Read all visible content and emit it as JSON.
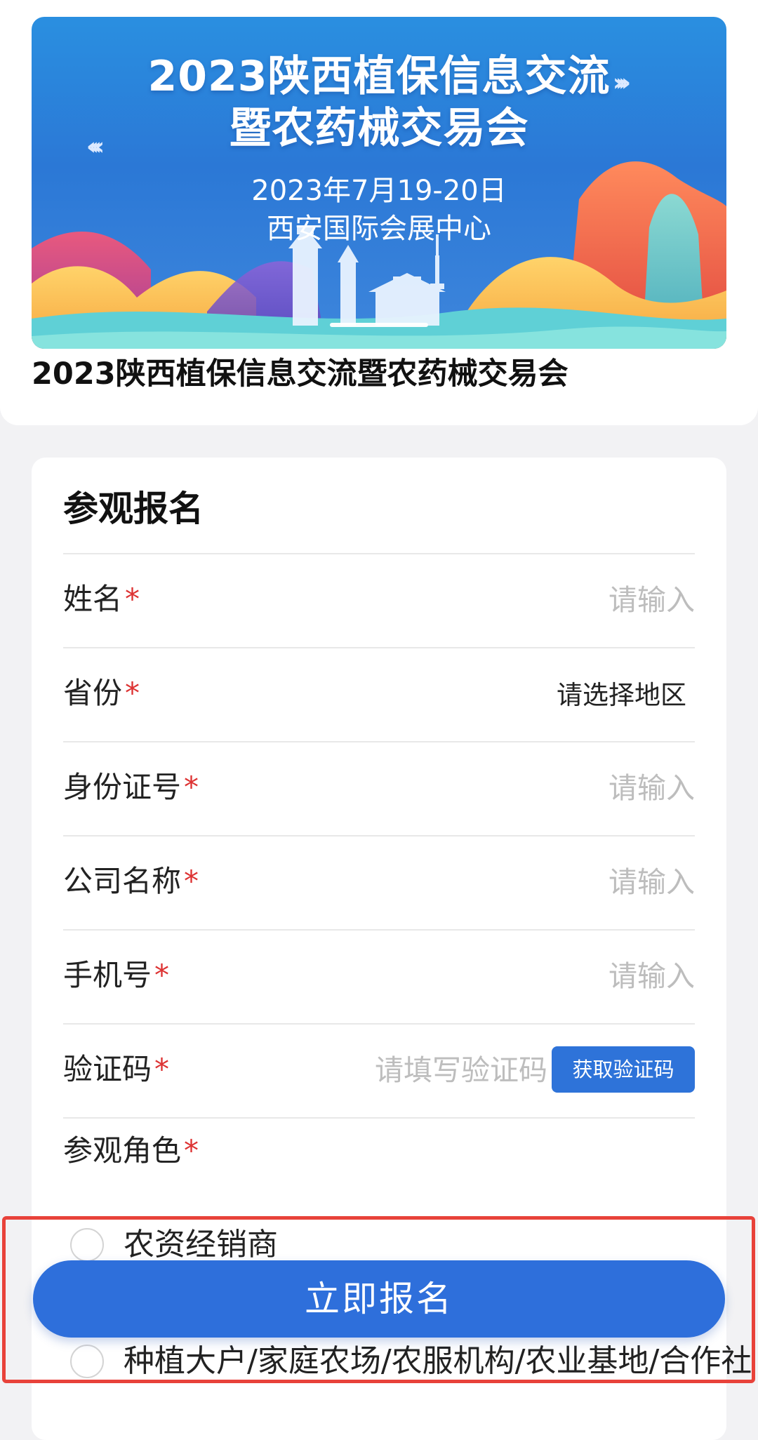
{
  "banner": {
    "title_line1": "2023陕西植保信息交流",
    "title_line2": "暨农药械交易会",
    "date": "2023年7月19-20日",
    "venue": "西安国际会展中心",
    "chevrons": "››››"
  },
  "event_title": "2023陕西植保信息交流暨农药械交易会",
  "form": {
    "heading": "参观报名",
    "required_mark": "*",
    "fields": [
      {
        "label": "姓名",
        "placeholder": "请输入"
      },
      {
        "label": "省份",
        "value": "请选择地区"
      },
      {
        "label": "身份证号",
        "placeholder": "请输入"
      },
      {
        "label": "公司名称",
        "placeholder": "请输入"
      },
      {
        "label": "手机号",
        "placeholder": "请输入"
      },
      {
        "label": "验证码",
        "placeholder": "请填写验证码",
        "button": "获取验证码"
      }
    ],
    "role_label": "参观角色",
    "roles": [
      "农资经销商",
      "种植大户/家庭农场/农服机构/农业基地/合作社"
    ]
  },
  "submit_label": "立即报名",
  "colors": {
    "primary": "#2e6fdb",
    "required": "#d33333",
    "highlight": "#e8423a"
  }
}
